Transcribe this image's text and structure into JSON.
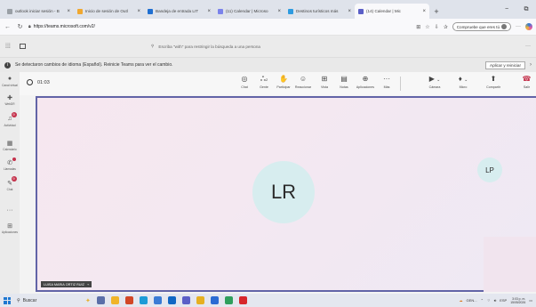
{
  "browser": {
    "tabs": [
      {
        "label": "outlook iniciar sesión - B",
        "color": "#9aa0a6",
        "active": false
      },
      {
        "label": "Inicio de sesión de Outl",
        "color": "#f0a830",
        "active": false
      },
      {
        "label": "Bandeja de entrada LIT",
        "color": "#1f6fd1",
        "active": false
      },
      {
        "label": "(11) Calendar | Microso",
        "color": "#7b83eb",
        "active": false
      },
      {
        "label": "Destinos turísticos más",
        "color": "#2e9be0",
        "active": false
      },
      {
        "label": "(14) Calendar | Mic",
        "color": "#5b5fc7",
        "active": true
      }
    ],
    "new_tab": "+",
    "window_controls": {
      "minimize": "−",
      "maximize": "⧉"
    },
    "url": "https://teams.microsoft.com/v2/",
    "profile_label": "Compruebe que eres tú"
  },
  "teams": {
    "search_placeholder": "Escriba \"with\" para restringir la búsqueda a una persona",
    "more": "···"
  },
  "notice": {
    "text": "Se detectaron cambios de idioma (Español). Reinicie Teams para ver el cambio.",
    "apply_label": "Aplicar y reiniciar",
    "chevron": "›"
  },
  "rail": {
    "items": [
      {
        "id": "virtual",
        "label": "Canal virtual",
        "icon": "●"
      },
      {
        "id": "pinned",
        "label": "WebDR",
        "icon": "✚"
      },
      {
        "id": "activity",
        "label": "Actividad",
        "icon": "♫",
        "badge": "9"
      },
      {
        "id": "calendar",
        "label": "Calendario",
        "icon": "▦"
      },
      {
        "id": "calls",
        "label": "Llamadas",
        "icon": "✆"
      },
      {
        "id": "chat",
        "label": "Chat",
        "icon": "✎",
        "badge": "9"
      },
      {
        "id": "more",
        "label": "",
        "icon": "···"
      },
      {
        "id": "apps",
        "label": "Aplicaciones",
        "icon": "⊞"
      }
    ]
  },
  "meeting": {
    "timer": "01:03",
    "tools": [
      {
        "id": "chat",
        "label": "Chat",
        "icon": "◎"
      },
      {
        "id": "people",
        "label": "Gente",
        "icon": "ஃ",
        "count": "2"
      },
      {
        "id": "raise",
        "label": "Participar",
        "icon": "✋"
      },
      {
        "id": "react",
        "label": "Reaccionar",
        "icon": "☺"
      },
      {
        "id": "view",
        "label": "Vista",
        "icon": "⊞"
      },
      {
        "id": "notes",
        "label": "Notas",
        "icon": "▤"
      },
      {
        "id": "apps",
        "label": "Aplicaciones",
        "icon": "⊕"
      },
      {
        "id": "more",
        "label": "Más",
        "icon": "···"
      },
      {
        "id": "camera",
        "label": "Cámara",
        "icon": "▶"
      },
      {
        "id": "mic",
        "label": "Micro",
        "icon": "♦"
      },
      {
        "id": "share",
        "label": "Compartir",
        "icon": "⬆"
      }
    ],
    "leave_label": "Salir",
    "participant_initials": "LR",
    "participant_name": "LUISA MARIA ORTIZ RUIZ",
    "self_initials": "LP"
  },
  "taskbar": {
    "search_label": "Buscar",
    "tray_text": "GEN...",
    "lang": "ESP",
    "time": "3:03 p. m.",
    "date": "15/05/2026"
  }
}
